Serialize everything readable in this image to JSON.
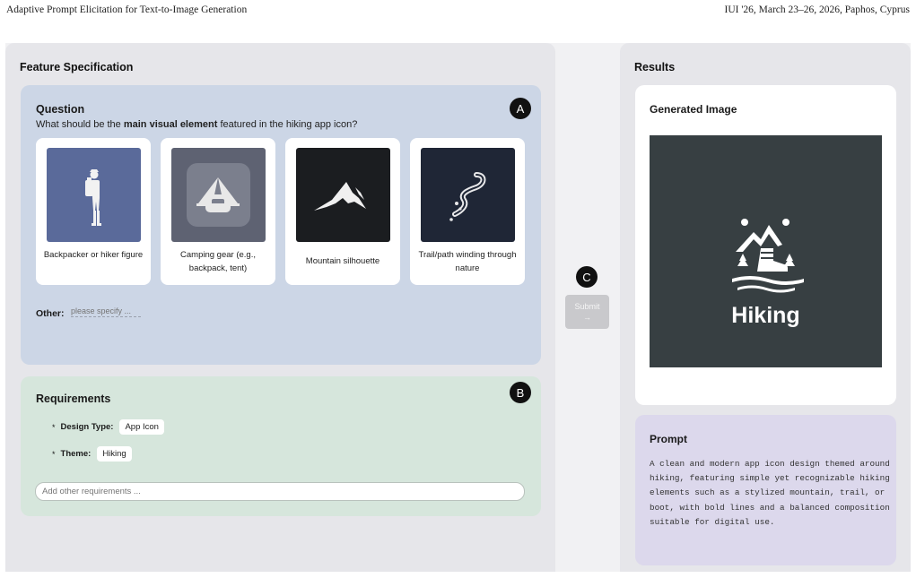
{
  "running_head": {
    "left": "Adaptive Prompt Elicitation for Text-to-Image Generation",
    "right": "IUI '26, March 23–26, 2026, Paphos, Cyprus"
  },
  "left_panel": {
    "title": "Feature Specification",
    "question": {
      "badge": "A",
      "heading": "Question",
      "text_before": "What should be the ",
      "text_bold": "main visual element",
      "text_after": " featured in the hiking app icon?",
      "options": [
        {
          "label": "Backpacker or hiker figure",
          "icon": "hiker-icon"
        },
        {
          "label": "Camping gear (e.g., backpack, tent)",
          "icon": "camping-gear-icon"
        },
        {
          "label": "Mountain silhouette",
          "icon": "mountain-icon"
        },
        {
          "label": "Trail/path winding through nature",
          "icon": "trail-icon"
        }
      ],
      "other_label": "Other:",
      "other_placeholder": "please specify ..."
    },
    "requirements": {
      "badge": "B",
      "heading": "Requirements",
      "items": [
        {
          "key": "Design Type:",
          "value": "App Icon"
        },
        {
          "key": "Theme:",
          "value": "Hiking"
        }
      ],
      "bullet": "*",
      "input_placeholder": "Add other requirements ..."
    }
  },
  "submit": {
    "badge": "C",
    "label": "Submit",
    "arrow": "→"
  },
  "right_panel": {
    "title": "Results",
    "generated": {
      "heading": "Generated Image",
      "image_text": "Hiking"
    },
    "prompt": {
      "heading": "Prompt",
      "text": "A clean and modern app icon design themed around hiking, featuring simple yet recognizable hiking elements such as a stylized mountain, trail, or boot, with bold lines and a balanced composition suitable for digital use."
    }
  },
  "colors": {
    "panel_bg": "#e6e6ea",
    "question_bg": "#ccd6e6",
    "requirements_bg": "#d6e6dc",
    "prompt_bg": "#dcd8ec",
    "generated_image_bg": "#373f42",
    "submit_disabled": "#c9c9cc"
  }
}
